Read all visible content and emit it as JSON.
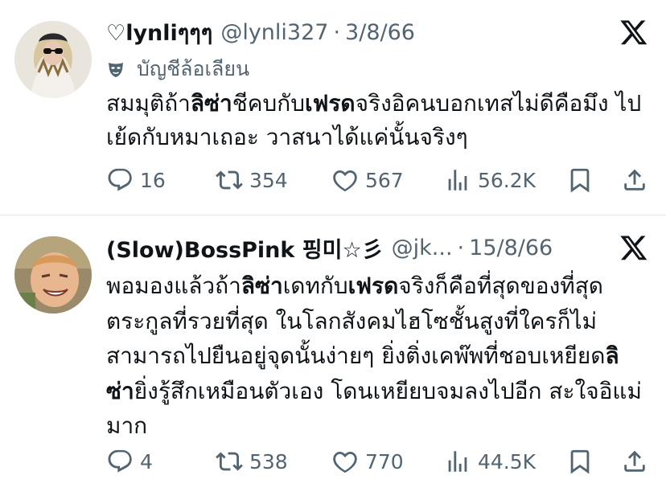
{
  "tweets": [
    {
      "name": "♡lynliๆๆๆ",
      "handle": "@lynli327",
      "separator": "·",
      "date": "3/8/66",
      "parody_label": "บัญชีล้อเลียน",
      "text_parts": [
        "สมมุติถ้า",
        "ลิซ่า",
        "ชีคบกับ",
        "เฟรด",
        "จริงอิคนบอกเทสไม่ดีคือมึง ไปเย้ดกับหมาเถอะ วาสนาได้แค่นั้นจริงๆ"
      ],
      "stats": {
        "replies": "16",
        "reposts": "354",
        "likes": "567",
        "views": "56.2K"
      }
    },
    {
      "name": "(Slow)BossPink 핑미☆彡",
      "handle": "@jk...",
      "separator": "·",
      "date": "15/8/66",
      "text_parts": [
        "พอมองแล้วถ้า",
        "ลิซ่า",
        "เดทกับ",
        "เฟรด",
        "จริงก็คือที่สุดของที่สุด ตระกูลที่รวยที่สุด ในโลกสังคมไฮโซชั้นสูงที่ใครก็ไม่สามารถไปยืนอยู่จุดนั้นง่ายๆ ยิ่งติ่งเคพ๊พที่ชอบเหยียด",
        "ลิซ่า",
        "ยิ่งรู้สึกเหมือนตัวเอง โดนเหยียบจมลงไปอีก สะใจอิแม่มาก"
      ],
      "stats": {
        "replies": "4",
        "reposts": "538",
        "likes": "770",
        "views": "44.5K"
      }
    }
  ],
  "icons": {
    "reply": "reply-icon",
    "repost": "repost-icon",
    "like": "heart-icon",
    "views": "views-icon",
    "bookmark": "bookmark-icon",
    "share": "share-icon",
    "logo": "x-logo-icon",
    "parody": "mask-icon"
  },
  "colors": {
    "text": "#0f1419",
    "muted": "#536471",
    "divider": "#e6e9ec"
  }
}
